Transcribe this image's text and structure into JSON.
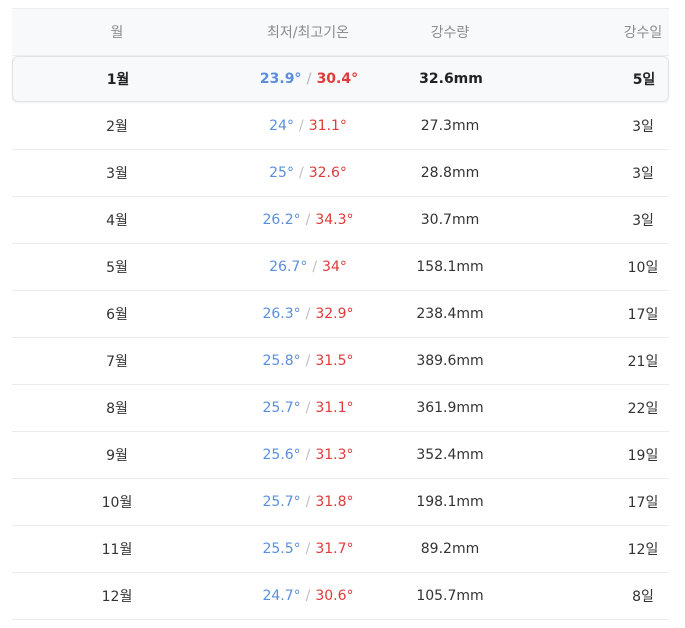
{
  "header": {
    "month": "월",
    "temp": "최저/최고기온",
    "rain": "강수량",
    "days": "강수일"
  },
  "colors": {
    "low": "#5b8fde",
    "high": "#e03a3a"
  },
  "rows": [
    {
      "month": "1월",
      "low": "23.9°",
      "high": "30.4°",
      "rain": "32.6mm",
      "days": "5일",
      "selected": true
    },
    {
      "month": "2월",
      "low": "24°",
      "high": "31.1°",
      "rain": "27.3mm",
      "days": "3일"
    },
    {
      "month": "3월",
      "low": "25°",
      "high": "32.6°",
      "rain": "28.8mm",
      "days": "3일"
    },
    {
      "month": "4월",
      "low": "26.2°",
      "high": "34.3°",
      "rain": "30.7mm",
      "days": "3일"
    },
    {
      "month": "5월",
      "low": "26.7°",
      "high": "34°",
      "rain": "158.1mm",
      "days": "10일"
    },
    {
      "month": "6월",
      "low": "26.3°",
      "high": "32.9°",
      "rain": "238.4mm",
      "days": "17일"
    },
    {
      "month": "7월",
      "low": "25.8°",
      "high": "31.5°",
      "rain": "389.6mm",
      "days": "21일"
    },
    {
      "month": "8월",
      "low": "25.7°",
      "high": "31.1°",
      "rain": "361.9mm",
      "days": "22일"
    },
    {
      "month": "9월",
      "low": "25.6°",
      "high": "31.3°",
      "rain": "352.4mm",
      "days": "19일"
    },
    {
      "month": "10월",
      "low": "25.7°",
      "high": "31.8°",
      "rain": "198.1mm",
      "days": "17일"
    },
    {
      "month": "11월",
      "low": "25.5°",
      "high": "31.7°",
      "rain": "89.2mm",
      "days": "12일"
    },
    {
      "month": "12월",
      "low": "24.7°",
      "high": "30.6°",
      "rain": "105.7mm",
      "days": "8일"
    }
  ]
}
